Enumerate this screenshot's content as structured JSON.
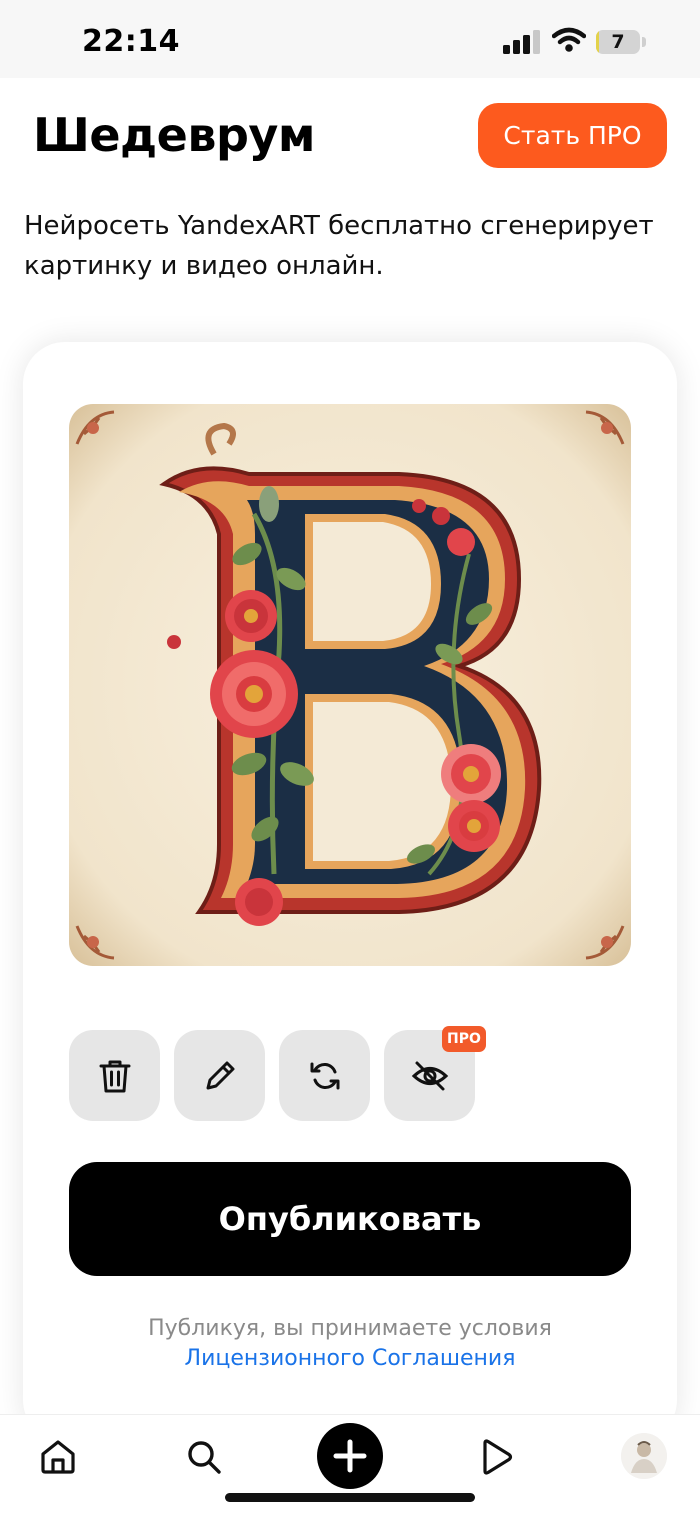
{
  "status_bar": {
    "time": "22:14",
    "battery_level": "7",
    "battery_fraction": 0.07
  },
  "header": {
    "title": "Шедеврум",
    "pro_button_label": "Стать ПРО"
  },
  "subtitle": "Нейросеть YandexART бесплатно сгенерирует картинку и видео онлайн.",
  "artwork": {
    "letter": "B",
    "colors": {
      "parchment": "#f4ead6",
      "navy": "#1b2e45",
      "gold": "#e6a55c",
      "red": "#b8352c",
      "flower": "#e1454b",
      "leaf": "#6d8d4c"
    }
  },
  "actions": {
    "delete_icon": "trash-icon",
    "edit_icon": "pencil-icon",
    "regenerate_icon": "refresh-icon",
    "hide_icon": "eye-off-icon",
    "pro_badge": "ПРО"
  },
  "publish_button_label": "Опубликовать",
  "terms": {
    "text": "Публикуя, вы принимаете условия",
    "link": "Лицензионного Соглашения"
  },
  "bottom_nav": {
    "items": [
      "home-icon",
      "search-icon",
      "plus-icon",
      "play-icon",
      "avatar"
    ]
  },
  "accent_colors": {
    "pro_orange": "#fd5a1e",
    "link_blue": "#1a73e8"
  }
}
